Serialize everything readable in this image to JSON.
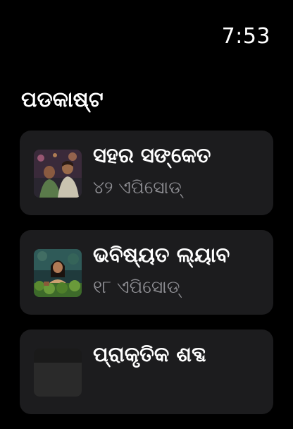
{
  "status": {
    "time": "7:53"
  },
  "page": {
    "title": "ପଡକାଷ୍ଟ"
  },
  "podcasts": [
    {
      "title": "ସହର ସଙ୍କେତ",
      "episodes": "୪୨ ଏପିସୋଡ୍",
      "artwork": "two-people-city-night"
    },
    {
      "title": "ଭବିଷ୍ୟତ ଲ୍ୟାବ",
      "episodes": "୧୮ ଏପିସୋଡ୍",
      "artwork": "woman-with-plants"
    },
    {
      "title": "ପ୍ରାକୃତିକ ଶବ୍ଦ",
      "episodes": "",
      "artwork": "dark-artwork"
    }
  ],
  "colors": {
    "background": "#000000",
    "card": "#1c1c1e",
    "secondary_text": "#8e8e93"
  }
}
